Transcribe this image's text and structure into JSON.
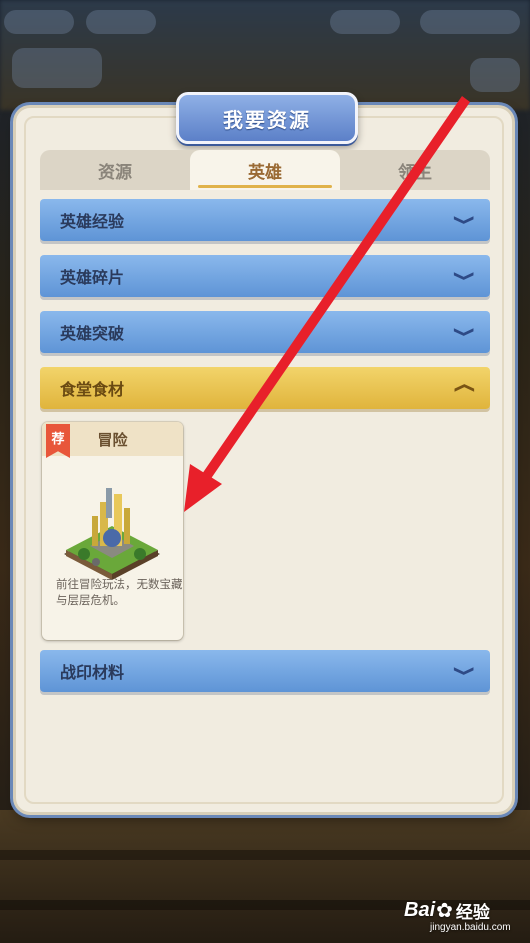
{
  "dialog": {
    "title": "我要资源"
  },
  "tabs": [
    {
      "label": "资源",
      "active": false
    },
    {
      "label": "英雄",
      "active": true
    },
    {
      "label": "领主",
      "active": false
    }
  ],
  "sections": [
    {
      "label": "英雄经验",
      "expanded": false
    },
    {
      "label": "英雄碎片",
      "expanded": false
    },
    {
      "label": "英雄突破",
      "expanded": false
    },
    {
      "label": "食堂食材",
      "expanded": true
    },
    {
      "label": "战印材料",
      "expanded": false
    }
  ],
  "card": {
    "badge": "荐",
    "title": "冒险",
    "description": "前往冒险玩法，无数宝藏与层层危机。"
  },
  "icons": {
    "collapsed": "chevron-down-icon",
    "expanded": "chevron-up-icon"
  },
  "colors": {
    "accent_blue": "#5e94d6",
    "accent_gold": "#e0b43c",
    "badge_red": "#e8563a",
    "arrow_red": "#e8202a"
  },
  "watermark": {
    "logo": "Bai",
    "logo_tail": "经验",
    "sub": "jingyan.baidu.com"
  }
}
